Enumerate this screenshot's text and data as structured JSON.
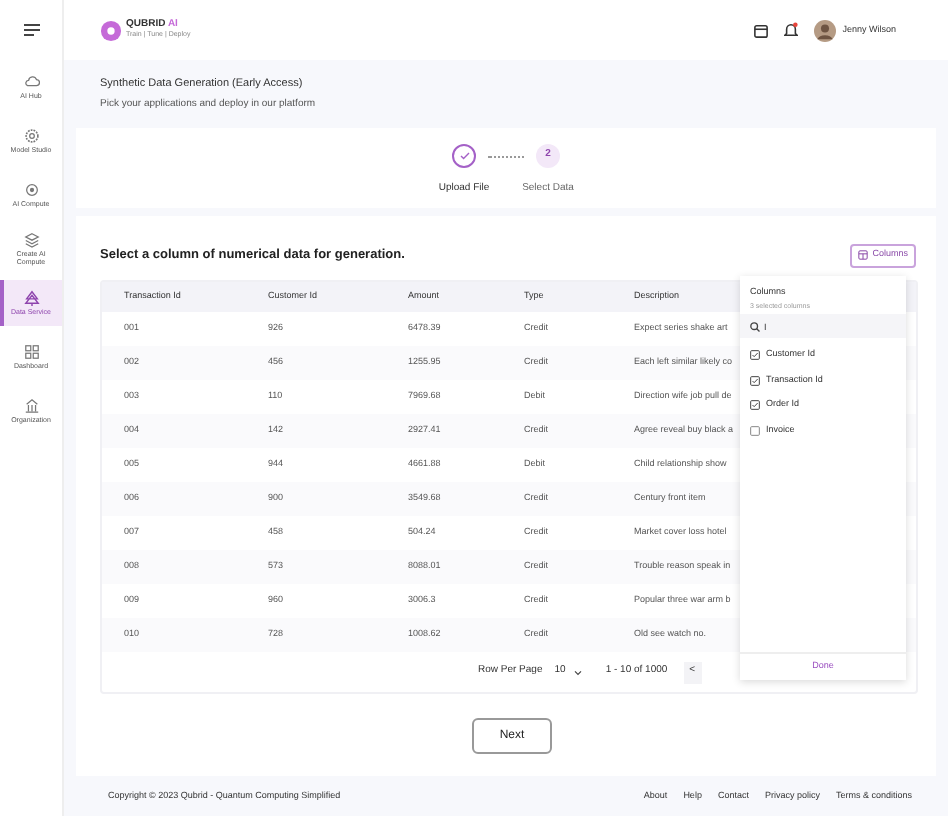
{
  "sidebar": {
    "items": [
      {
        "label": "AI Hub",
        "selected": false
      },
      {
        "label": "Model Studio",
        "selected": false
      },
      {
        "label": "AI Compute",
        "selected": false
      },
      {
        "label": "Create AI Compute",
        "selected": false
      },
      {
        "label": "Data Service",
        "selected": true
      },
      {
        "label": "Dashboard",
        "selected": false
      },
      {
        "label": "Organization",
        "selected": false
      }
    ]
  },
  "header": {
    "brand": "QUBRID",
    "brand_accent": "AI",
    "tagline": "Train | Tune | Deploy",
    "user": "Jenny Wilson"
  },
  "page": {
    "title": "Synthetic Data Generation (Early Access)",
    "subtitle": "Pick your applications and deploy in our platform"
  },
  "steps": [
    {
      "label": "Upload File",
      "completed": true
    },
    {
      "number": "2",
      "label": "Select Data",
      "completed": false
    }
  ],
  "section": {
    "heading": "Select a column of numerical data for generation.",
    "columns_button": "Columns"
  },
  "table": {
    "columns": [
      "Transaction Id",
      "Customer Id",
      "Amount",
      "Type",
      "Description"
    ],
    "rows": [
      [
        "001",
        "926",
        "6478.39",
        "Credit",
        "Expect series shake art"
      ],
      [
        "002",
        "456",
        "1255.95",
        "Credit",
        "Each left similar likely co"
      ],
      [
        "003",
        "110",
        "7969.68",
        "Debit",
        "Direction wife job pull de"
      ],
      [
        "004",
        "142",
        "2927.41",
        "Credit",
        "Agree reveal buy black a"
      ],
      [
        "005",
        "944",
        "4661.88",
        "Debit",
        "Child relationship show"
      ],
      [
        "006",
        "900",
        "3549.68",
        "Credit",
        "Century front item"
      ],
      [
        "007",
        "458",
        "504.24",
        "Credit",
        "Market cover loss hotel"
      ],
      [
        "008",
        "573",
        "8088.01",
        "Credit",
        "Trouble reason speak in"
      ],
      [
        "009",
        "960",
        "3006.3",
        "Credit",
        "Popular three war arm b"
      ],
      [
        "010",
        "728",
        "1008.62",
        "Credit",
        "Old see watch no."
      ]
    ]
  },
  "pagination": {
    "rows_per_page_label": "Row Per Page",
    "rows_per_page": "10",
    "range": "1 - 10 of 1000",
    "prev": "<"
  },
  "column_picker": {
    "title": "Columns",
    "subtitle": "3 selected columns",
    "search_value": "I",
    "options": [
      {
        "label": "Customer Id",
        "checked": true
      },
      {
        "label": "Transaction Id",
        "checked": true
      },
      {
        "label": "Order Id",
        "checked": true
      },
      {
        "label": "Invoice",
        "checked": false
      }
    ],
    "done": "Done"
  },
  "next_button": "Next",
  "footer": {
    "copyright": "Copyright © 2023 Qubrid - Quantum Computing Simplified",
    "links": [
      "About",
      "Help",
      "Contact",
      "Privacy policy",
      "Terms & conditions"
    ]
  }
}
